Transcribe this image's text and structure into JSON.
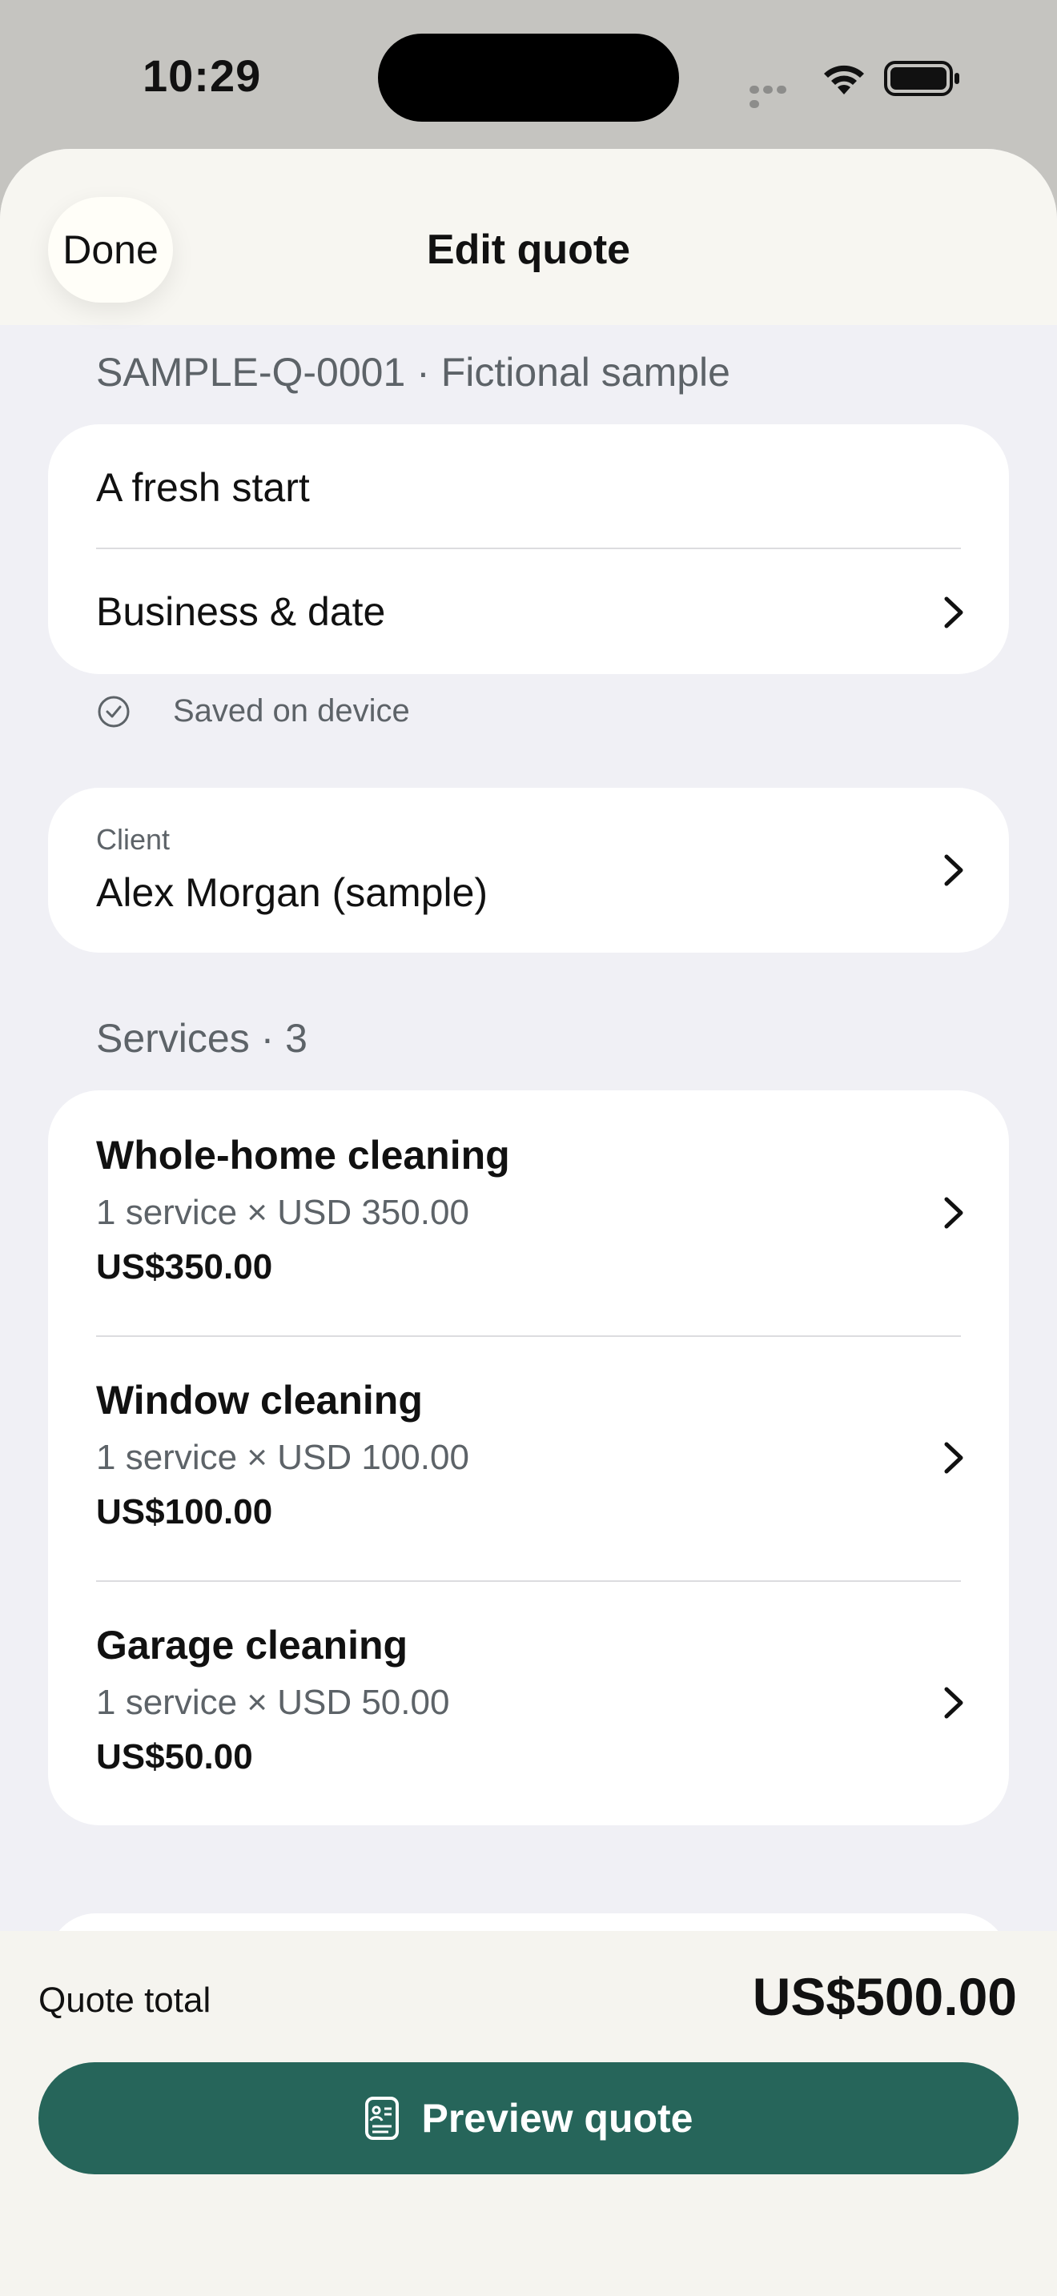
{
  "status_bar": {
    "time": "10:29"
  },
  "header": {
    "done_label": "Done",
    "title": "Edit quote"
  },
  "quote": {
    "reference": "SAMPLE-Q-0001 · Fictional sample",
    "title_value": "A fresh start",
    "business_date_label": "Business & date",
    "saved_status": "Saved on device"
  },
  "client": {
    "label": "Client",
    "name": "Alex Morgan (sample)"
  },
  "services": {
    "section_label": "Services · 3",
    "items": [
      {
        "name": "Whole-home cleaning",
        "detail": "1 service × USD 350.00",
        "price": "US$350.00"
      },
      {
        "name": "Window cleaning",
        "detail": "1 service × USD 100.00",
        "price": "US$100.00"
      },
      {
        "name": "Garage cleaning",
        "detail": "1 service × USD 50.00",
        "price": "US$50.00"
      }
    ]
  },
  "footer": {
    "total_label": "Quote total",
    "total_value": "US$500.00",
    "preview_label": "Preview quote"
  },
  "colors": {
    "accent": "#26655a",
    "status_bar_bg": "#c5c4c0",
    "sheet_bg": "#f0f0f5",
    "header_bg": "#f7f6f1",
    "secondary_text": "#5d6368"
  },
  "icons": {
    "row_disclosure": "chevron-right-icon",
    "saved": "check-circle-icon",
    "preview": "document-preview-icon",
    "wifi": "wifi-icon",
    "battery": "battery-icon",
    "cellular": "cellular-dots-icon"
  }
}
